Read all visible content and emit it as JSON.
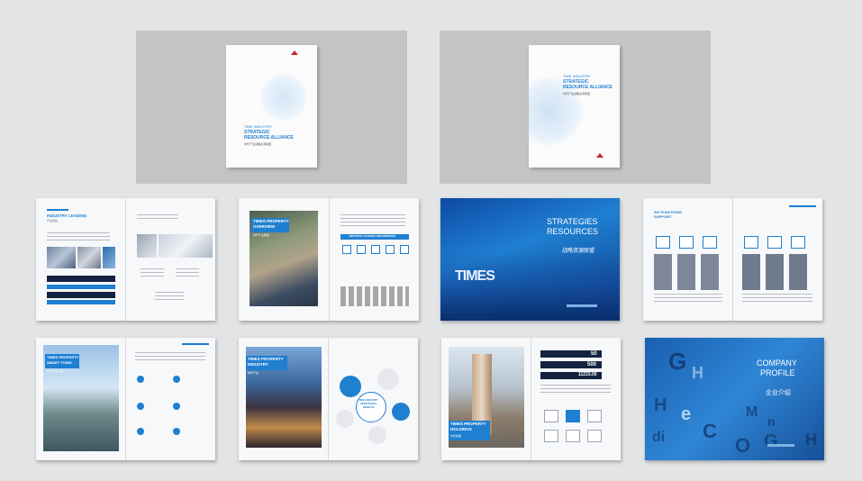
{
  "cover1": {
    "line1": "TIME INDUSTRY",
    "line2": "STRATEGIC",
    "line3": "RESOURCE ALLIANCE",
    "subtitle": "时代产业战略资源联盟"
  },
  "cover2": {
    "line1": "TIME INDUSTRY",
    "line2": "STRATEGIC",
    "line3": "RESOURCE ALLIANCE",
    "subtitle": "时代产业战略资源联盟"
  },
  "spread1": {
    "title": "INDUSTRY LEADING",
    "subtitle": "产业领先"
  },
  "spread2": {
    "title1": "TIMES PROPERTY",
    "title2": "OVERVIEW",
    "subtitle": "时代产业概述",
    "box_title": "INDUSTRY LEADING ENTERPRISES"
  },
  "spread3": {
    "title1": "STRATEGIES",
    "title2": "RESOURCES",
    "subtitle": "战略资源联盟",
    "sign": "TIMES"
  },
  "spread4": {
    "title1": "SIX FUNCTIONS",
    "title2": "SUPPORT"
  },
  "spread5": {
    "title1": "TIMES PROPERTY",
    "title2": "SMART TOWN",
    "subtitle": "时代产业小镇"
  },
  "spread6": {
    "title1": "TIMES PROPERTY",
    "title2": "INDUSTRY",
    "subtitle": "时代产业",
    "center1": "TIMES INDUSTRY",
    "center2": "OPERATIONAL",
    "center3": "BENEFITS"
  },
  "spread7": {
    "title1": "TIMES PROPERTY",
    "title2": "HOLDINGS",
    "subtitle": "时代控股",
    "num1": "50",
    "num2": "500",
    "num3": "11223.00"
  },
  "spread8": {
    "title1": "COMPANY",
    "title2": "PROFILE",
    "subtitle": "企业介绍",
    "letters": [
      "G",
      "H",
      "H",
      "e",
      "di",
      "C",
      "O",
      "M",
      "n",
      "H",
      "G"
    ]
  }
}
